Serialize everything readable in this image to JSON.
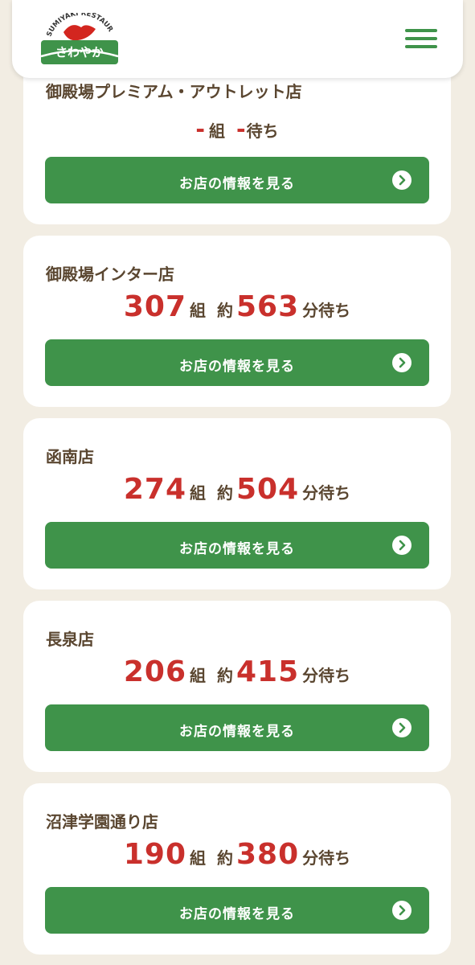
{
  "header": {
    "logo_text": "SUMIYAKI RESTAURANT",
    "logo_name": "さわやか",
    "menu_icon": "hamburger-menu-icon"
  },
  "colors": {
    "accent_green": "#3f934a",
    "wait_red": "#c9302c",
    "text_brown": "#5a4630",
    "background": "#f2ede3"
  },
  "stores": [
    {
      "name": "御殿場プレミアム・アウトレット店",
      "groups": "-",
      "group_unit": "組",
      "minutes": "-",
      "minute_unit": "待ち",
      "button_label": "お店の情報を見る"
    },
    {
      "name": "御殿場インター店",
      "groups": "307",
      "group_unit": "組",
      "approx": "約",
      "minutes": "563",
      "minute_unit": "分待ち",
      "button_label": "お店の情報を見る"
    },
    {
      "name": "函南店",
      "groups": "274",
      "group_unit": "組",
      "approx": "約",
      "minutes": "504",
      "minute_unit": "分待ち",
      "button_label": "お店の情報を見る"
    },
    {
      "name": "長泉店",
      "groups": "206",
      "group_unit": "組",
      "approx": "約",
      "minutes": "415",
      "minute_unit": "分待ち",
      "button_label": "お店の情報を見る"
    },
    {
      "name": "沼津学園通り店",
      "groups": "190",
      "group_unit": "組",
      "approx": "約",
      "minutes": "380",
      "minute_unit": "分待ち",
      "button_label": "お店の情報を見る"
    }
  ]
}
